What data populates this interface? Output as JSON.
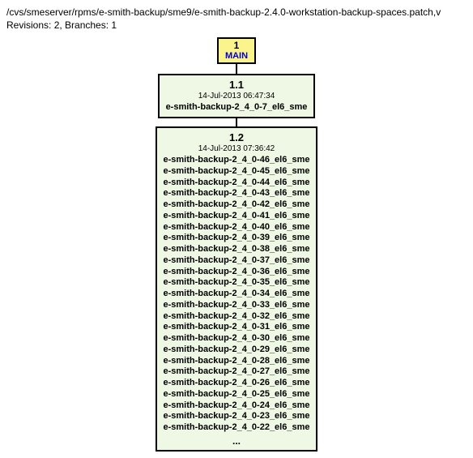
{
  "header": {
    "path": "/cvs/smeserver/rpms/e-smith-backup/sme9/e-smith-backup-2.4.0-workstation-backup-spaces.patch,v",
    "meta": "Revisions: 2, Branches: 1"
  },
  "main_node": {
    "num": "1",
    "label": "MAIN"
  },
  "rev1": {
    "title": "1.1",
    "date": "14-Jul-2013 06:47:34",
    "tag": "e-smith-backup-2_4_0-7_el6_sme"
  },
  "rev2": {
    "title": "1.2",
    "date": "14-Jul-2013 07:36:42",
    "tags": [
      "e-smith-backup-2_4_0-46_el6_sme",
      "e-smith-backup-2_4_0-45_el6_sme",
      "e-smith-backup-2_4_0-44_el6_sme",
      "e-smith-backup-2_4_0-43_el6_sme",
      "e-smith-backup-2_4_0-42_el6_sme",
      "e-smith-backup-2_4_0-41_el6_sme",
      "e-smith-backup-2_4_0-40_el6_sme",
      "e-smith-backup-2_4_0-39_el6_sme",
      "e-smith-backup-2_4_0-38_el6_sme",
      "e-smith-backup-2_4_0-37_el6_sme",
      "e-smith-backup-2_4_0-36_el6_sme",
      "e-smith-backup-2_4_0-35_el6_sme",
      "e-smith-backup-2_4_0-34_el6_sme",
      "e-smith-backup-2_4_0-33_el6_sme",
      "e-smith-backup-2_4_0-32_el6_sme",
      "e-smith-backup-2_4_0-31_el6_sme",
      "e-smith-backup-2_4_0-30_el6_sme",
      "e-smith-backup-2_4_0-29_el6_sme",
      "e-smith-backup-2_4_0-28_el6_sme",
      "e-smith-backup-2_4_0-27_el6_sme",
      "e-smith-backup-2_4_0-26_el6_sme",
      "e-smith-backup-2_4_0-25_el6_sme",
      "e-smith-backup-2_4_0-24_el6_sme",
      "e-smith-backup-2_4_0-23_el6_sme",
      "e-smith-backup-2_4_0-22_el6_sme"
    ],
    "ellipsis": "..."
  }
}
